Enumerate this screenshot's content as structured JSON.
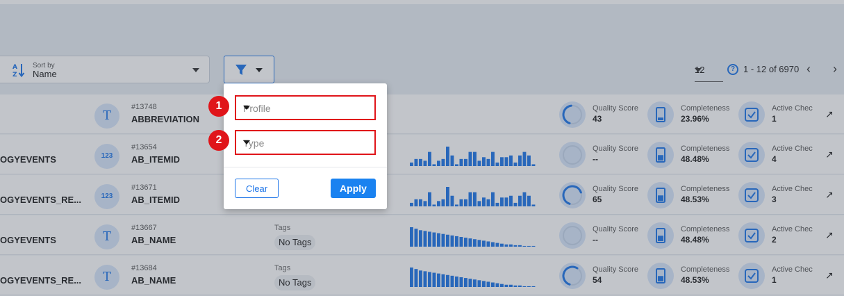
{
  "toolbar": {
    "sort_caption": "Sort by",
    "sort_value": "Name",
    "per_page": "12",
    "range": "1 - 12 of 6970"
  },
  "filter_popup": {
    "profile_placeholder": "Profile",
    "type_placeholder": "Type",
    "badge_1": "1",
    "badge_2": "2",
    "clear_label": "Clear",
    "apply_label": "Apply"
  },
  "rows": [
    {
      "name": "",
      "type_icon": "T",
      "id": "#13748",
      "field": "ABBREVIATION",
      "tags_label": "",
      "tags_value": "",
      "histogram": [],
      "quality_label": "Quality Score",
      "quality_value": "43",
      "quality_pct": 43,
      "completeness_label": "Completeness",
      "completeness_value": "23.96%",
      "completeness_pct": 23.96,
      "checks_label": "Active Chec",
      "checks_value": "1"
    },
    {
      "name": "OGYEVENTS",
      "type_icon": "123",
      "id": "#13654",
      "field": "AB_ITEMID",
      "tags_label": "",
      "tags_value": "",
      "histogram": [
        2,
        4,
        4,
        3,
        8,
        1,
        3,
        4,
        11,
        6,
        1,
        4,
        4,
        8,
        8,
        3,
        5,
        4,
        8,
        2,
        5,
        5,
        6,
        2,
        6,
        8,
        6,
        1
      ],
      "quality_label": "Quality Score",
      "quality_value": "--",
      "quality_pct": 0,
      "completeness_label": "Completeness",
      "completeness_value": "48.48%",
      "completeness_pct": 48.48,
      "checks_label": "Active Chec",
      "checks_value": "4"
    },
    {
      "name": "OGYEVENTS_RE...",
      "type_icon": "123",
      "id": "#13671",
      "field": "AB_ITEMID",
      "tags_label": "",
      "tags_value": "",
      "histogram": [
        2,
        4,
        4,
        3,
        8,
        1,
        3,
        4,
        11,
        6,
        1,
        4,
        4,
        8,
        8,
        3,
        5,
        4,
        8,
        2,
        5,
        5,
        6,
        2,
        6,
        8,
        6,
        1
      ],
      "quality_label": "Quality Score",
      "quality_value": "65",
      "quality_pct": 65,
      "completeness_label": "Completeness",
      "completeness_value": "48.53%",
      "completeness_pct": 48.53,
      "checks_label": "Active Chec",
      "checks_value": "3"
    },
    {
      "name": "OGYEVENTS",
      "type_icon": "T",
      "id": "#13667",
      "field": "AB_NAME",
      "tags_label": "Tags",
      "tags_value": "No Tags",
      "histogram": [
        26,
        24,
        22,
        21,
        20,
        19,
        18,
        17,
        16,
        15,
        14,
        13,
        12,
        11,
        10,
        9,
        8,
        7,
        6,
        5,
        4,
        3,
        3,
        2,
        2,
        1,
        1,
        1
      ],
      "quality_label": "Quality Score",
      "quality_value": "--",
      "quality_pct": 0,
      "completeness_label": "Completeness",
      "completeness_value": "48.48%",
      "completeness_pct": 48.48,
      "checks_label": "Active Chec",
      "checks_value": "2"
    },
    {
      "name": "OGYEVENTS_RE...",
      "type_icon": "T",
      "id": "#13684",
      "field": "AB_NAME",
      "tags_label": "Tags",
      "tags_value": "No Tags",
      "histogram": [
        26,
        24,
        22,
        21,
        20,
        19,
        18,
        17,
        16,
        15,
        14,
        13,
        12,
        11,
        10,
        9,
        8,
        7,
        6,
        5,
        4,
        3,
        3,
        2,
        2,
        1,
        1,
        1
      ],
      "quality_label": "Quality Score",
      "quality_value": "54",
      "quality_pct": 54,
      "completeness_label": "Completeness",
      "completeness_value": "48.53%",
      "completeness_pct": 48.53,
      "checks_label": "Active Chec",
      "checks_value": "1"
    }
  ],
  "icons": {
    "sort": "sort-az-icon",
    "filter": "funnel-icon",
    "help": "question-circle-icon",
    "prev": "chevron-left-icon",
    "next": "chevron-right-icon",
    "open": "arrow-up-right-icon",
    "completeness": "battery-icon",
    "checks": "checkbox-icon"
  },
  "colors": {
    "accent": "#1a73e8",
    "highlight_border": "#e0151a",
    "apply_button": "#1a82f0"
  }
}
